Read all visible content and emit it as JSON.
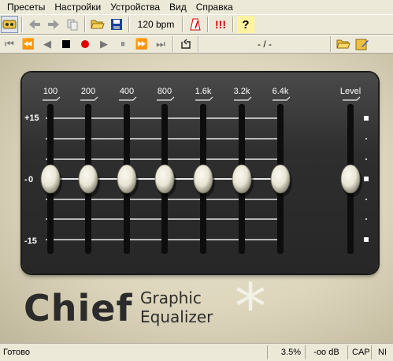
{
  "menu": [
    "Пресеты",
    "Настройки",
    "Устройства",
    "Вид",
    "Справка"
  ],
  "toolbar": {
    "bpm": "120 bpm",
    "warning": "!!!",
    "help": "?"
  },
  "transport": {
    "position": "- / -"
  },
  "equalizer": {
    "bands": [
      {
        "label": "100",
        "gain_db": 0
      },
      {
        "label": "200",
        "gain_db": 0
      },
      {
        "label": "400",
        "gain_db": 0
      },
      {
        "label": "800",
        "gain_db": 0
      },
      {
        "label": "1.6k",
        "gain_db": 0
      },
      {
        "label": "3.2k",
        "gain_db": 0
      },
      {
        "label": "6.4k",
        "gain_db": 0
      }
    ],
    "level": {
      "label": "Level",
      "value_db": 0
    },
    "scale": {
      "top": "+15",
      "mid": "0",
      "bottom": "-15"
    }
  },
  "brand": {
    "name": "Chief",
    "line1": "Graphic",
    "line2": "Equalizer",
    "mark": "*"
  },
  "status": {
    "text": "Готово",
    "percent": "3.5%",
    "db": "-oo dB",
    "cap": "CAP",
    "num": "NI"
  },
  "colors": {
    "panel": "#2e2e2e",
    "knob": "#e8e4d4",
    "background": "#ddd6bd",
    "record": "#e00000",
    "warning": "#cc0000"
  }
}
